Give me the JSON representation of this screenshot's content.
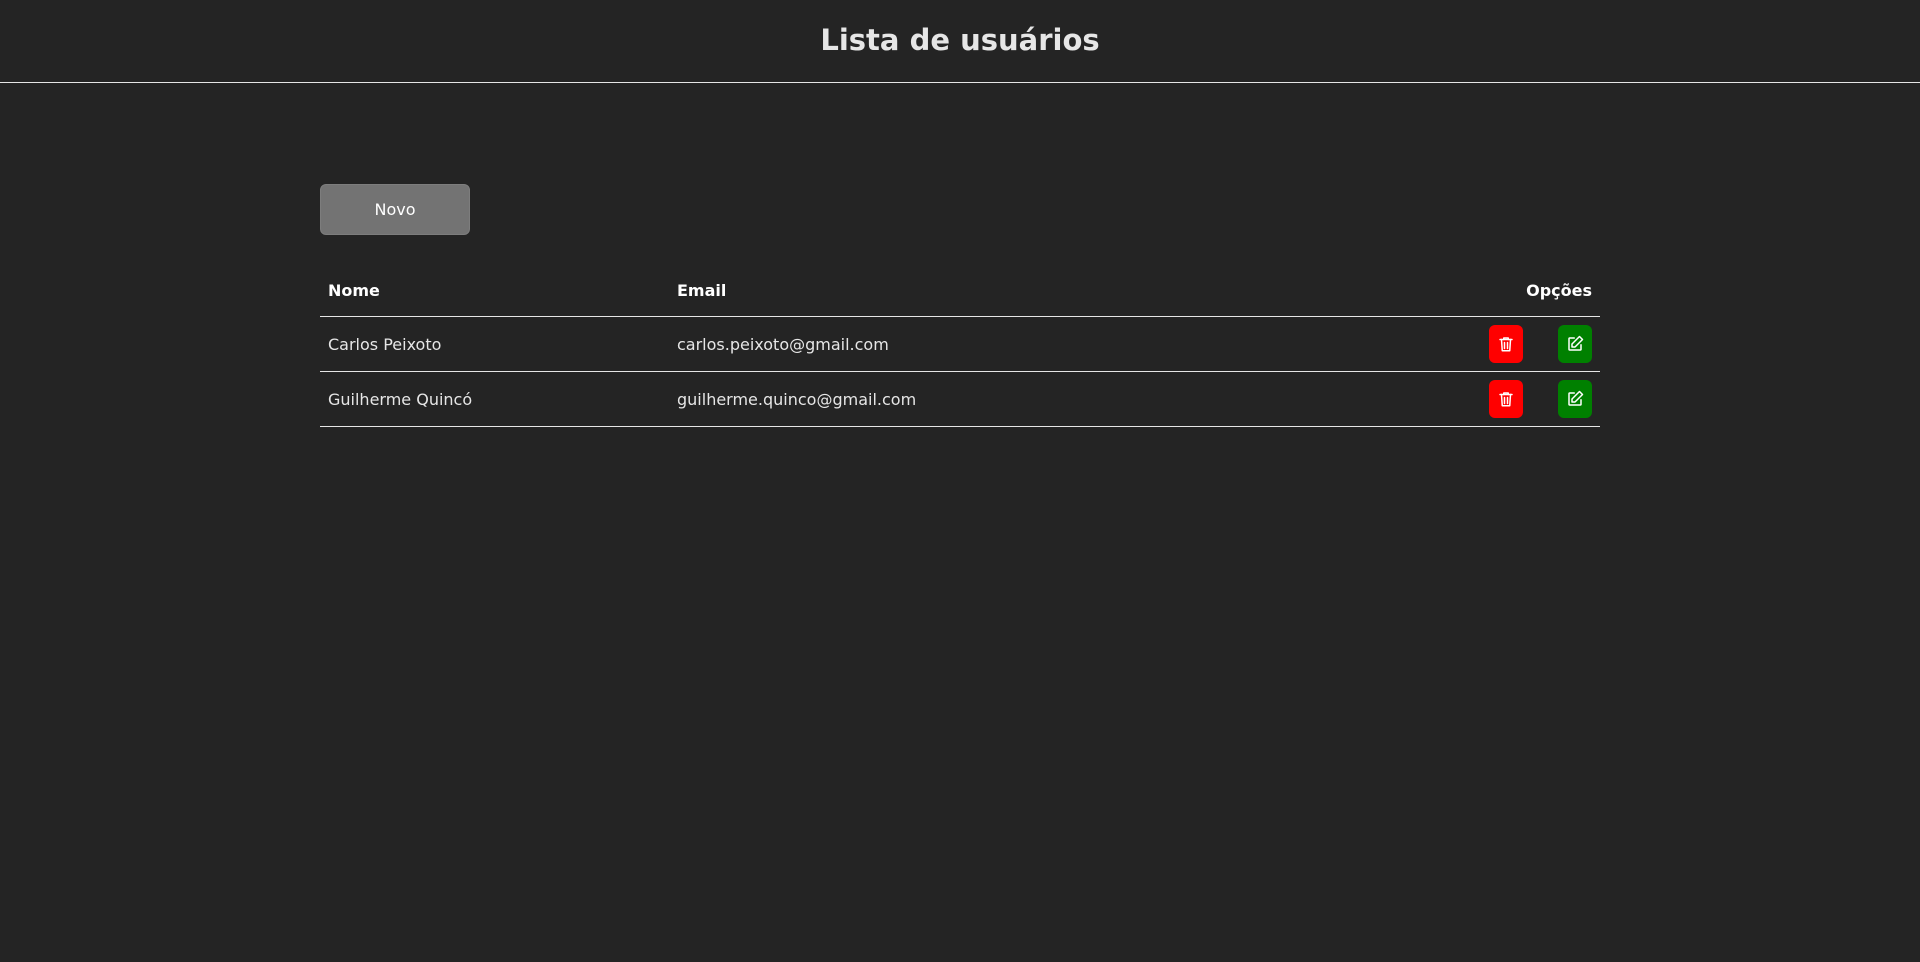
{
  "header": {
    "title": "Lista de usuários"
  },
  "toolbar": {
    "new_label": "Novo"
  },
  "table": {
    "columns": {
      "name": "Nome",
      "email": "Email",
      "options": "Opções"
    },
    "rows": [
      {
        "name": "Carlos Peixoto",
        "email": "carlos.peixoto@gmail.com"
      },
      {
        "name": "Guilherme Quincó",
        "email": "guilherme.quinco@gmail.com"
      }
    ]
  },
  "icons": {
    "delete": "trash-icon",
    "edit": "edit-icon"
  },
  "colors": {
    "delete": "#ff0000",
    "edit": "#008000",
    "background": "#242424",
    "button": "#737373"
  }
}
